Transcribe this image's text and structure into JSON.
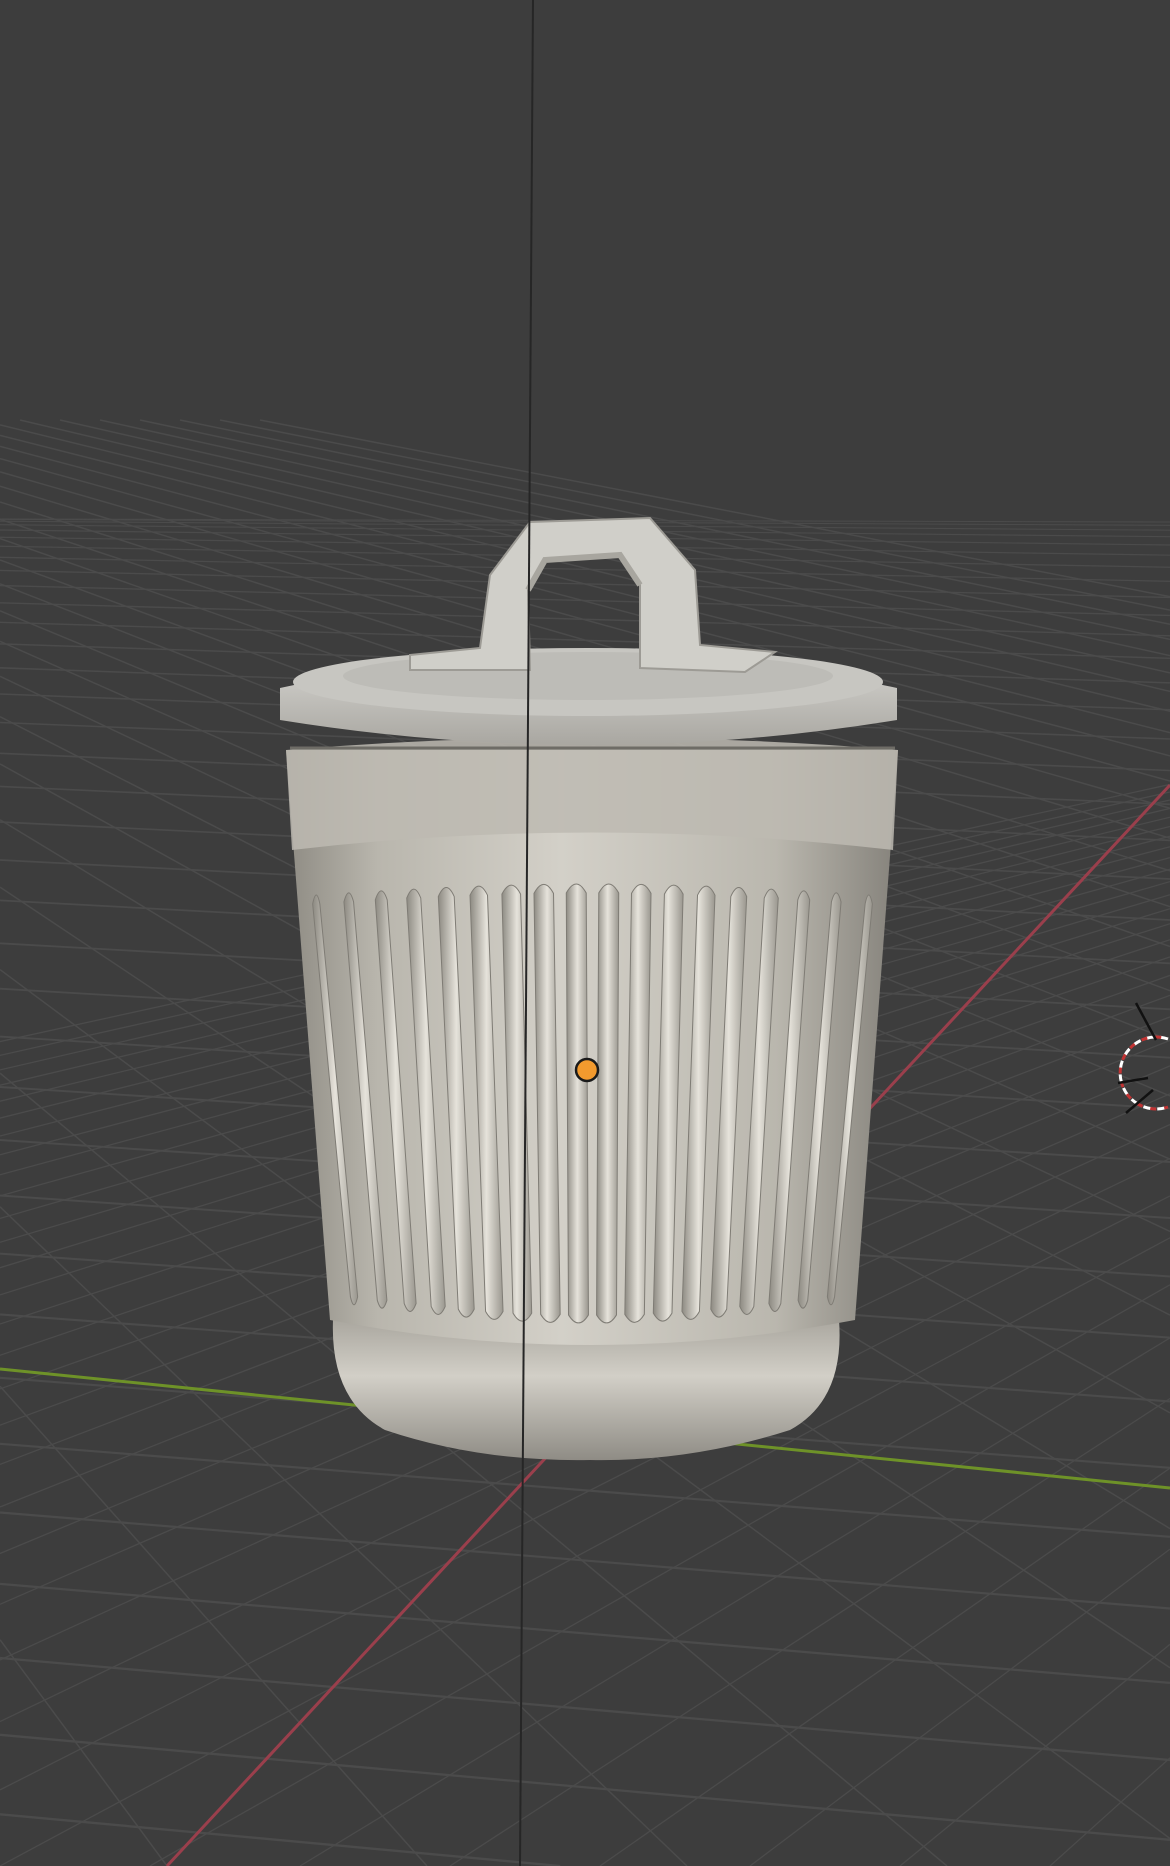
{
  "viewport": {
    "background": "#3d3d3d",
    "grid_color": "#4b4b4b",
    "x_axis_color": "#9a3f4c",
    "y_axis_color": "#6e9228",
    "object_color": "#c9c6bd",
    "origin_color": "#f29a2e"
  },
  "scene": {
    "object": "trash-can",
    "icons": [
      "origin-dot-icon",
      "light-icon"
    ]
  }
}
